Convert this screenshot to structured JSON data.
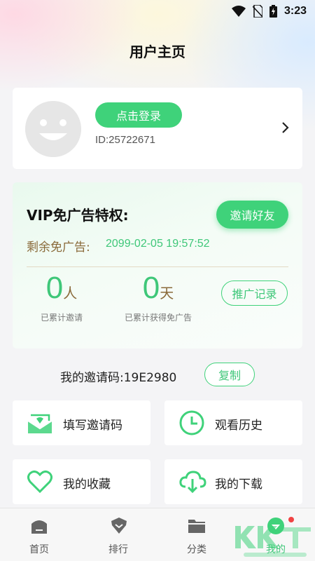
{
  "status_bar": {
    "time": "3:23"
  },
  "header": {
    "title": "用户主页"
  },
  "profile": {
    "login_label": "点击登录",
    "user_id": "ID:25722671"
  },
  "vip": {
    "title": "VIP免广告特权:",
    "invite_button": "邀请好友",
    "remaining_label": "剩余免广告:",
    "remaining_value": "2099-02-05 19:57:52",
    "stats": [
      {
        "value": "0",
        "unit": "人",
        "label": "已累计邀请"
      },
      {
        "value": "0",
        "unit": "天",
        "label": "已累计获得免广告"
      }
    ],
    "promo_button": "推广记录"
  },
  "invite_code": {
    "label": "我的邀请码:19E2980",
    "copy_button": "复制"
  },
  "tiles": [
    {
      "label": "填写邀请码",
      "icon": "mail-icon"
    },
    {
      "label": "观看历史",
      "icon": "clock-icon"
    },
    {
      "label": "我的收藏",
      "icon": "heart-icon"
    },
    {
      "label": "我的下载",
      "icon": "cloud-download-icon"
    }
  ],
  "bottom_nav": [
    {
      "label": "首页",
      "icon": "home-icon"
    },
    {
      "label": "排行",
      "icon": "rank-icon"
    },
    {
      "label": "分类",
      "icon": "folder-icon"
    },
    {
      "label": "我的",
      "icon": "profile-icon",
      "active": true
    }
  ],
  "colors": {
    "accent": "#3fd27a",
    "accent_text": "#3fc779",
    "brown": "#8a6a3a",
    "badge": "#f04343"
  }
}
